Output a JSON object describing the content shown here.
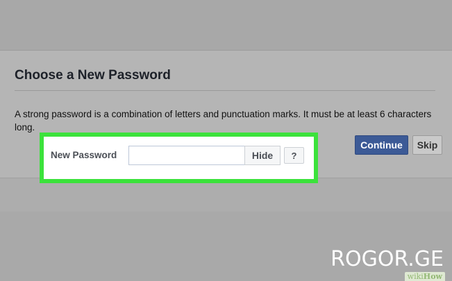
{
  "dialog": {
    "title": "Choose a New Password",
    "description": "A strong password is a combination of letters and punctuation marks. It must be at least 6 characters long."
  },
  "password_field": {
    "label": "New Password",
    "value": "",
    "placeholder": "",
    "hide_label": "Hide",
    "help_label": "?"
  },
  "footer": {
    "continue_label": "Continue",
    "skip_label": "Skip"
  },
  "watermarks": {
    "site": "ROGOR.GE",
    "wiki": "wiki",
    "how": "How"
  },
  "colors": {
    "highlight": "#3be23b",
    "primary_button": "#3c5a96"
  }
}
